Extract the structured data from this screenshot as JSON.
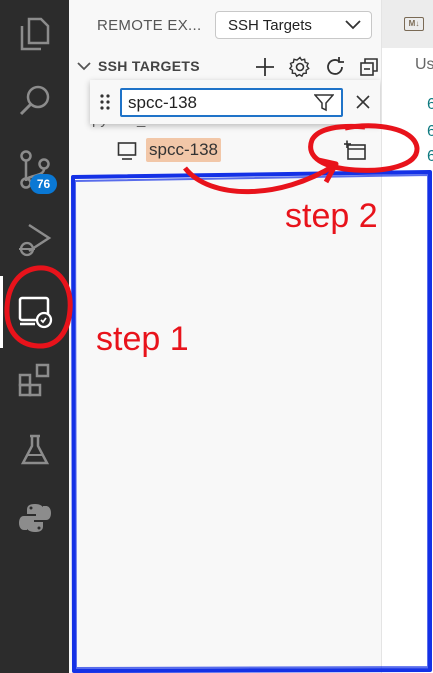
{
  "activity_bar": {
    "items": [
      "explorer",
      "search",
      "source-control",
      "run-and-debug",
      "remote-explorer",
      "extensions",
      "testing",
      "python"
    ],
    "source_control_badge": "76"
  },
  "sidebar": {
    "header_title": "REMOTE EX...",
    "target_select": "SSH Targets",
    "section_title": "SSH TARGETS",
    "hidden_row_label": "python_tutorials",
    "host_label": "spcc-138"
  },
  "find_widget": {
    "value": "spcc-138"
  },
  "editor": {
    "tab_icon_text": "M↓",
    "partial_text": "Us",
    "code_digits": [
      "6",
      "6",
      "6"
    ]
  },
  "annotations": {
    "step1": "step 1",
    "step2": "step 2",
    "colors": {
      "red": "#e8131b",
      "blue": "#1431e6"
    }
  }
}
